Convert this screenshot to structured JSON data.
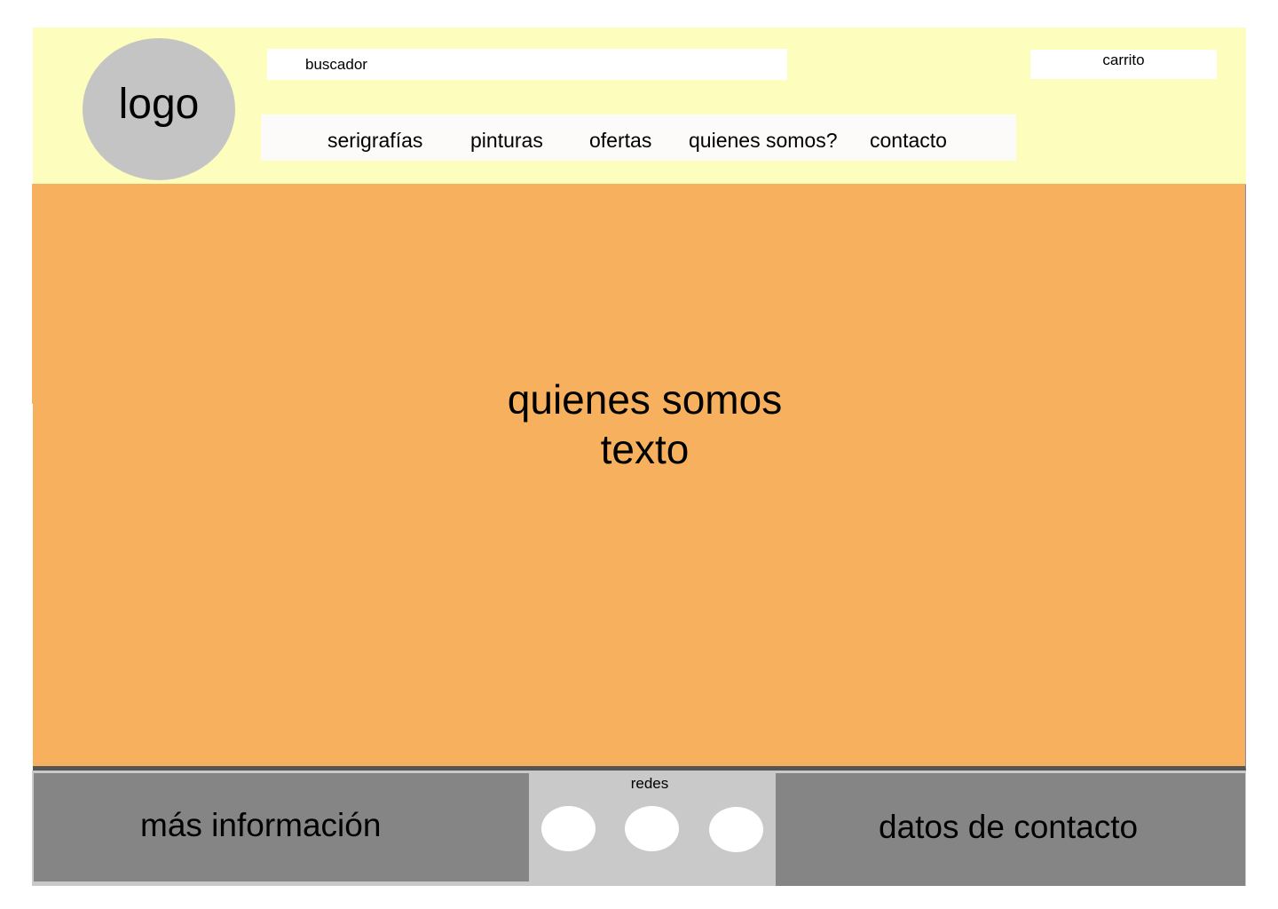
{
  "header": {
    "logo_text": "logo",
    "search_placeholder": "buscador",
    "cart_label": "carrito",
    "nav": {
      "items": [
        {
          "label": "serigrafías"
        },
        {
          "label": "pinturas"
        },
        {
          "label": "ofertas"
        },
        {
          "label": "quienes somos?"
        },
        {
          "label": "contacto"
        }
      ]
    }
  },
  "main": {
    "title": "quienes somos",
    "body": "texto"
  },
  "footer": {
    "more_info_label": "más información",
    "social_label": "redes",
    "contact_label": "datos de contacto"
  },
  "colors": {
    "header_bg": "#fdfdbe",
    "main_bg": "#f7b15e",
    "footer_dark": "#858585",
    "footer_light": "#c9c9c9",
    "logo_bg": "#c4c4c4"
  }
}
